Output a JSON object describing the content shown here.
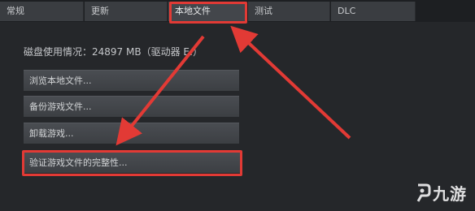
{
  "tabs": [
    {
      "label": "常规",
      "active": false
    },
    {
      "label": "更新",
      "active": false
    },
    {
      "label": "本地文件",
      "active": true
    },
    {
      "label": "测试",
      "active": false
    },
    {
      "label": "DLC",
      "active": false
    }
  ],
  "disk_usage": "磁盘使用情况：24897 MB（驱动器 E:）",
  "buttons": {
    "browse": "浏览本地文件...",
    "backup": "备份游戏文件...",
    "uninstall": "卸载游戏...",
    "verify": "验证游戏文件的完整性..."
  },
  "annotation_color": "#e23a35",
  "watermark": "九游"
}
